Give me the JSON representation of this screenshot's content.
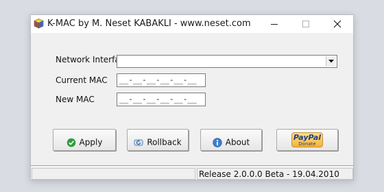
{
  "window": {
    "title": "K-MAC by M. Neset KABAKLI  -  www.neset.com",
    "app_icon": "rubiks-cube-icon",
    "controls": [
      "minimize-icon",
      "maximize-icon",
      "close-icon"
    ]
  },
  "form": {
    "network_interface_label": "Network Interface",
    "network_interface_value": "",
    "current_mac_label": "Current MAC",
    "current_mac_value": "__-__-__-__-__-__",
    "new_mac_label": "New MAC",
    "new_mac_value": "__-__-__-__-__-__"
  },
  "buttons": {
    "apply": {
      "label": "Apply",
      "icon": "check-icon"
    },
    "rollback": {
      "label": "Rollback",
      "icon": "rollback-icon"
    },
    "about": {
      "label": "About",
      "icon": "info-icon"
    },
    "donate": {
      "brand": "PayPal",
      "text": "Donate",
      "icon": "paypal-donate-icon"
    }
  },
  "status": {
    "left_panel": "",
    "release": "Release 2.0.0.0 Beta - 19.04.2010"
  },
  "colors": {
    "window_bg": "#f0f0f0",
    "check_green": "#2e9e3e",
    "info_blue": "#3f7fcf",
    "paypal_gold": "#f3b33c",
    "paypal_blue": "#1f3f8a"
  }
}
